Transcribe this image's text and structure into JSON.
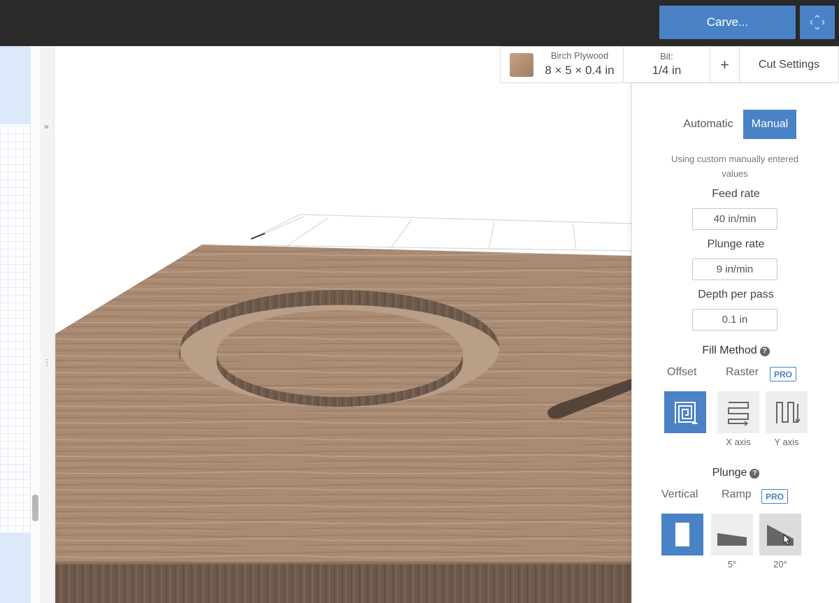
{
  "topbar": {
    "carve_label": "Carve..."
  },
  "toolbar": {
    "material_name": "Birch Plywood",
    "material_size": "8 × 5 × 0.4 in",
    "bit_label": "Bit:",
    "bit_value": "1/4 in",
    "add_label": "+",
    "cut_settings_label": "Cut Settings"
  },
  "panel": {
    "modes": {
      "automatic": "Automatic",
      "manual": "Manual",
      "selected": "Manual"
    },
    "description": "Using custom manually entered values",
    "feed_rate": {
      "label": "Feed rate",
      "value": "40 in/min"
    },
    "plunge_rate": {
      "label": "Plunge rate",
      "value": "9 in/min"
    },
    "depth_per_pass": {
      "label": "Depth per pass",
      "value": "0.1 in"
    },
    "fill_method": {
      "title": "Fill Method",
      "help_icon": "question-circle-icon",
      "offset_label": "Offset",
      "raster_label": "Raster",
      "pro_badge": "PRO",
      "options": [
        {
          "icon": "offset-spiral-icon",
          "caption": "",
          "selected": true
        },
        {
          "icon": "raster-x-axis-icon",
          "caption": "X axis",
          "selected": false
        },
        {
          "icon": "raster-y-axis-icon",
          "caption": "Y axis",
          "selected": false
        }
      ]
    },
    "plunge": {
      "title": "Plunge",
      "help_icon": "question-circle-icon",
      "vertical_label": "Vertical",
      "ramp_label": "Ramp",
      "pro_badge": "PRO",
      "options": [
        {
          "icon": "vertical-plunge-icon",
          "caption": "",
          "selected": true
        },
        {
          "icon": "ramp-5-icon",
          "caption": "5°",
          "selected": false
        },
        {
          "icon": "ramp-20-icon",
          "caption": "20°",
          "selected": false
        }
      ]
    }
  },
  "colors": {
    "accent": "#4a82c6",
    "topbar": "#2a2a2a",
    "wood": "#b09078"
  }
}
